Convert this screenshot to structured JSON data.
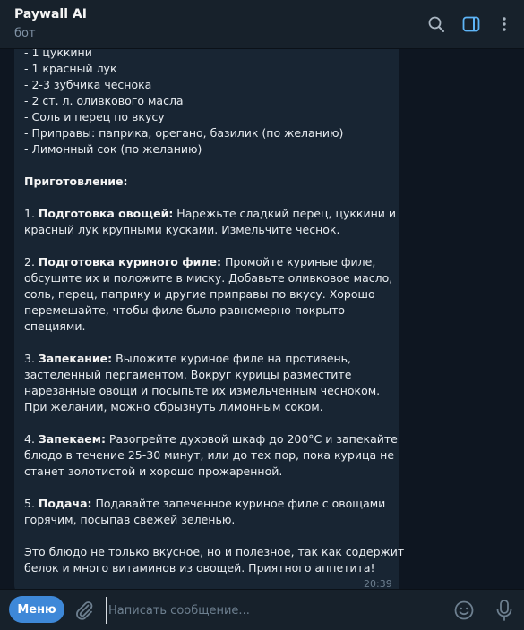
{
  "header": {
    "title": "Paywall AI",
    "subtitle": "бот",
    "icons": [
      "search-icon",
      "sidebar-toggle-icon",
      "more-vertical-icon"
    ],
    "accent_color": "#5eb5f7"
  },
  "message": {
    "lines": [
      {
        "b": "",
        "t": "- 1 цуккини"
      },
      {
        "b": "",
        "t": "- 1 красный лук"
      },
      {
        "b": "",
        "t": "- 2-3 зубчика чеснока"
      },
      {
        "b": "",
        "t": "- 2 ст. л. оливкового масла"
      },
      {
        "b": "",
        "t": "- Соль и перец по вкусу"
      },
      {
        "b": "",
        "t": "- Приправы: паприка, орегано, базилик (по желанию)"
      },
      {
        "b": "",
        "t": "- Лимонный сок (по желанию)"
      },
      {
        "b": "",
        "t": ""
      },
      {
        "b": "Приготовление:",
        "t": ""
      },
      {
        "b": "",
        "t": ""
      },
      {
        "p": "1. ",
        "b": "Подготовка овощей:",
        "t": " Нарежьте сладкий перец, цуккини и"
      },
      {
        "b": "",
        "t": "красный лук крупными кусками. Измельчите чеснок."
      },
      {
        "b": "",
        "t": ""
      },
      {
        "p": "2. ",
        "b": "Подготовка куриного филе:",
        "t": " Промойте куриные филе,"
      },
      {
        "b": "",
        "t": "обсушите их и положите в миску. Добавьте оливковое масло,"
      },
      {
        "b": "",
        "t": "соль, перец, паприку и другие приправы по вкусу. Хорошо"
      },
      {
        "b": "",
        "t": "перемешайте, чтобы филе было равномерно покрыто"
      },
      {
        "b": "",
        "t": "специями."
      },
      {
        "b": "",
        "t": ""
      },
      {
        "p": "3. ",
        "b": "Запекание:",
        "t": " Выложите куриное филе на противень,"
      },
      {
        "b": "",
        "t": "застеленный пергаментом. Вокруг курицы разместите"
      },
      {
        "b": "",
        "t": "нарезанные овощи и посыпьте их измельченным чесноком."
      },
      {
        "b": "",
        "t": "При желании, можно сбрызнуть лимонным соком."
      },
      {
        "b": "",
        "t": ""
      },
      {
        "p": "4. ",
        "b": "Запекаем:",
        "t": " Разогрейте духовой шкаф до 200°C и запекайте"
      },
      {
        "b": "",
        "t": "блюдо в течение 25-30 минут, или до тех пор, пока курица не"
      },
      {
        "b": "",
        "t": "станет золотистой и хорошо прожаренной."
      },
      {
        "b": "",
        "t": ""
      },
      {
        "p": "5. ",
        "b": "Подача:",
        "t": " Подавайте запеченное куриное филе с овощами"
      },
      {
        "b": "",
        "t": "горячим, посыпав свежей зеленью."
      },
      {
        "b": "",
        "t": ""
      },
      {
        "b": "",
        "t": "Это блюдо не только вкусное, но и полезное, так как содержит"
      },
      {
        "b": "",
        "t": "белок и много витаминов из овощей. Приятного аппетита!"
      }
    ],
    "time": "20:39"
  },
  "scroll_button": {
    "icon": "chevron-down-icon"
  },
  "footer": {
    "menu_label": "Меню",
    "input_placeholder": "Написать сообщение...",
    "input_value": "",
    "icons": [
      "paperclip-icon",
      "emoji-icon",
      "microphone-icon"
    ]
  },
  "colors": {
    "background": "#0e1621",
    "panel": "#17212b",
    "bubble": "#182533",
    "menu_button": "#3e88d8"
  }
}
